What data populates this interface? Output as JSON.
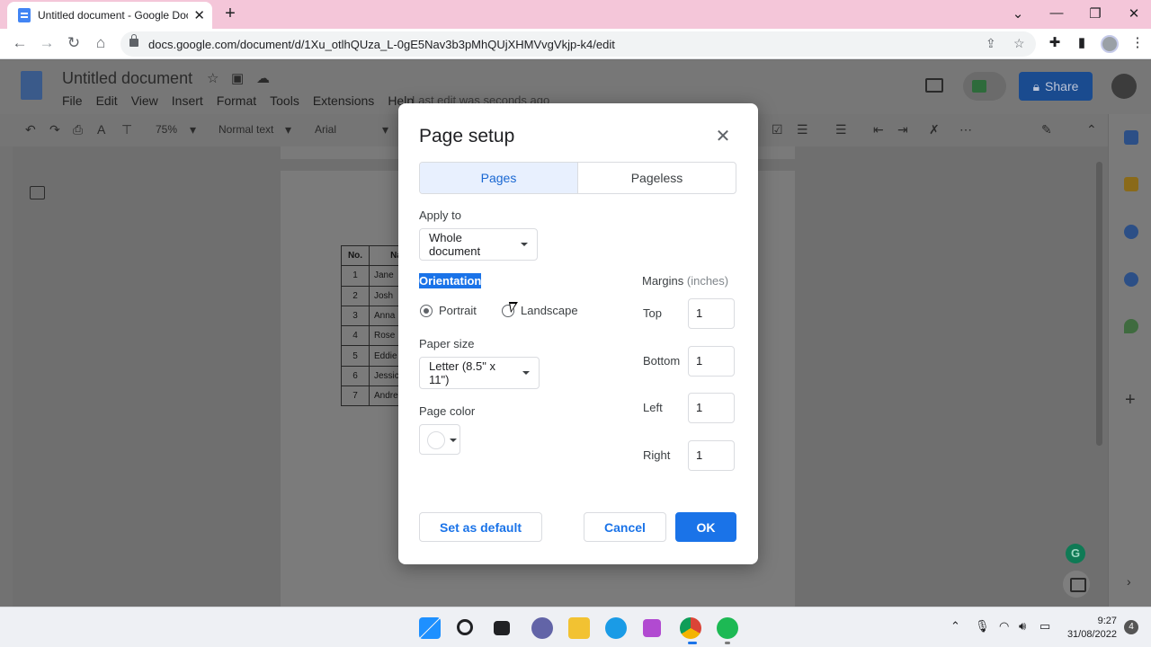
{
  "browser": {
    "tab_title": "Untitled document - Google Docs",
    "new_tab_icon": "plus-icon",
    "url": "docs.google.com/document/d/1Xu_otlhQUza_L-0gE5Nav3b3pMhQUjXHMVvgVkjp-k4/edit"
  },
  "docs": {
    "title": "Untitled document",
    "menu": [
      "File",
      "Edit",
      "View",
      "Insert",
      "Format",
      "Tools",
      "Extensions",
      "Help"
    ],
    "last_edit": "Last edit was seconds ago",
    "share_label": "Share",
    "toolbar": {
      "zoom": "75%",
      "style": "Normal text",
      "font": "Arial"
    },
    "table": {
      "headers": [
        "No.",
        "Na"
      ],
      "rows": [
        [
          "1",
          "Jane"
        ],
        [
          "2",
          "Josh"
        ],
        [
          "3",
          "Anna"
        ],
        [
          "4",
          "Rose"
        ],
        [
          "5",
          "Eddie"
        ],
        [
          "6",
          "Jessic"
        ],
        [
          "7",
          "Andre"
        ]
      ]
    }
  },
  "dialog": {
    "title": "Page setup",
    "tabs": [
      "Pages",
      "Pageless"
    ],
    "active_tab": "Pages",
    "apply_to_label": "Apply to",
    "apply_to_value": "Whole document",
    "orientation_label": "Orientation",
    "orientation_options": [
      "Portrait",
      "Landscape"
    ],
    "orientation_selected": "Portrait",
    "paper_size_label": "Paper size",
    "paper_size_value": "Letter (8.5\" x 11\")",
    "page_color_label": "Page color",
    "page_color_value": "#ffffff",
    "margins_label": "Margins",
    "margins_unit": "(inches)",
    "margins": {
      "top_label": "Top",
      "top": "1",
      "bottom_label": "Bottom",
      "bottom": "1",
      "left_label": "Left",
      "left": "1",
      "right_label": "Right",
      "right": "1"
    },
    "set_default_label": "Set as default",
    "cancel_label": "Cancel",
    "ok_label": "OK"
  },
  "taskbar": {
    "time": "9:27",
    "date": "31/08/2022",
    "notifications": "4"
  },
  "colors": {
    "accent": "#1a73e8",
    "tab_active_bg": "#e8f0fe",
    "tabstrip": "#f4c6d9"
  }
}
